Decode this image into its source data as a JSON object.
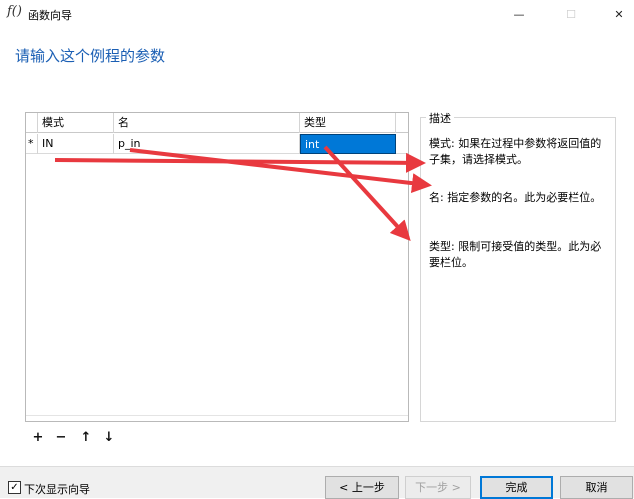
{
  "window": {
    "icon": "function-icon",
    "icon_glyph": "f()",
    "title": "函数向导",
    "min_glyph": "—",
    "max_glyph": "☐",
    "close_glyph": "✕"
  },
  "heading": "请输入这个例程的参数",
  "grid": {
    "columns": [
      "模式",
      "名",
      "类型"
    ],
    "rows": [
      {
        "marker": "*",
        "mode": "IN",
        "name": "p_in",
        "type": "int"
      }
    ]
  },
  "description": {
    "legend": "描述",
    "items": [
      "模式: 如果在过程中参数将返回值的子集，请选择模式。",
      "名: 指定参数的名。此为必要栏位。",
      "类型: 限制可接受值的类型。此为必要栏位。"
    ]
  },
  "toolbar": {
    "add": "+",
    "remove": "−",
    "up": "↑",
    "down": "↓"
  },
  "footer": {
    "show_wizard_checked": true,
    "check_glyph": "✓",
    "show_wizard_label": "下次显示向导",
    "prev_label": "< 上一步",
    "next_label": "下一步 >",
    "finish_label": "完成",
    "cancel_label": "取消"
  },
  "colors": {
    "heading": "#1b5fb4",
    "selection": "#0078d7",
    "annotation_arrow": "#e8393f"
  }
}
